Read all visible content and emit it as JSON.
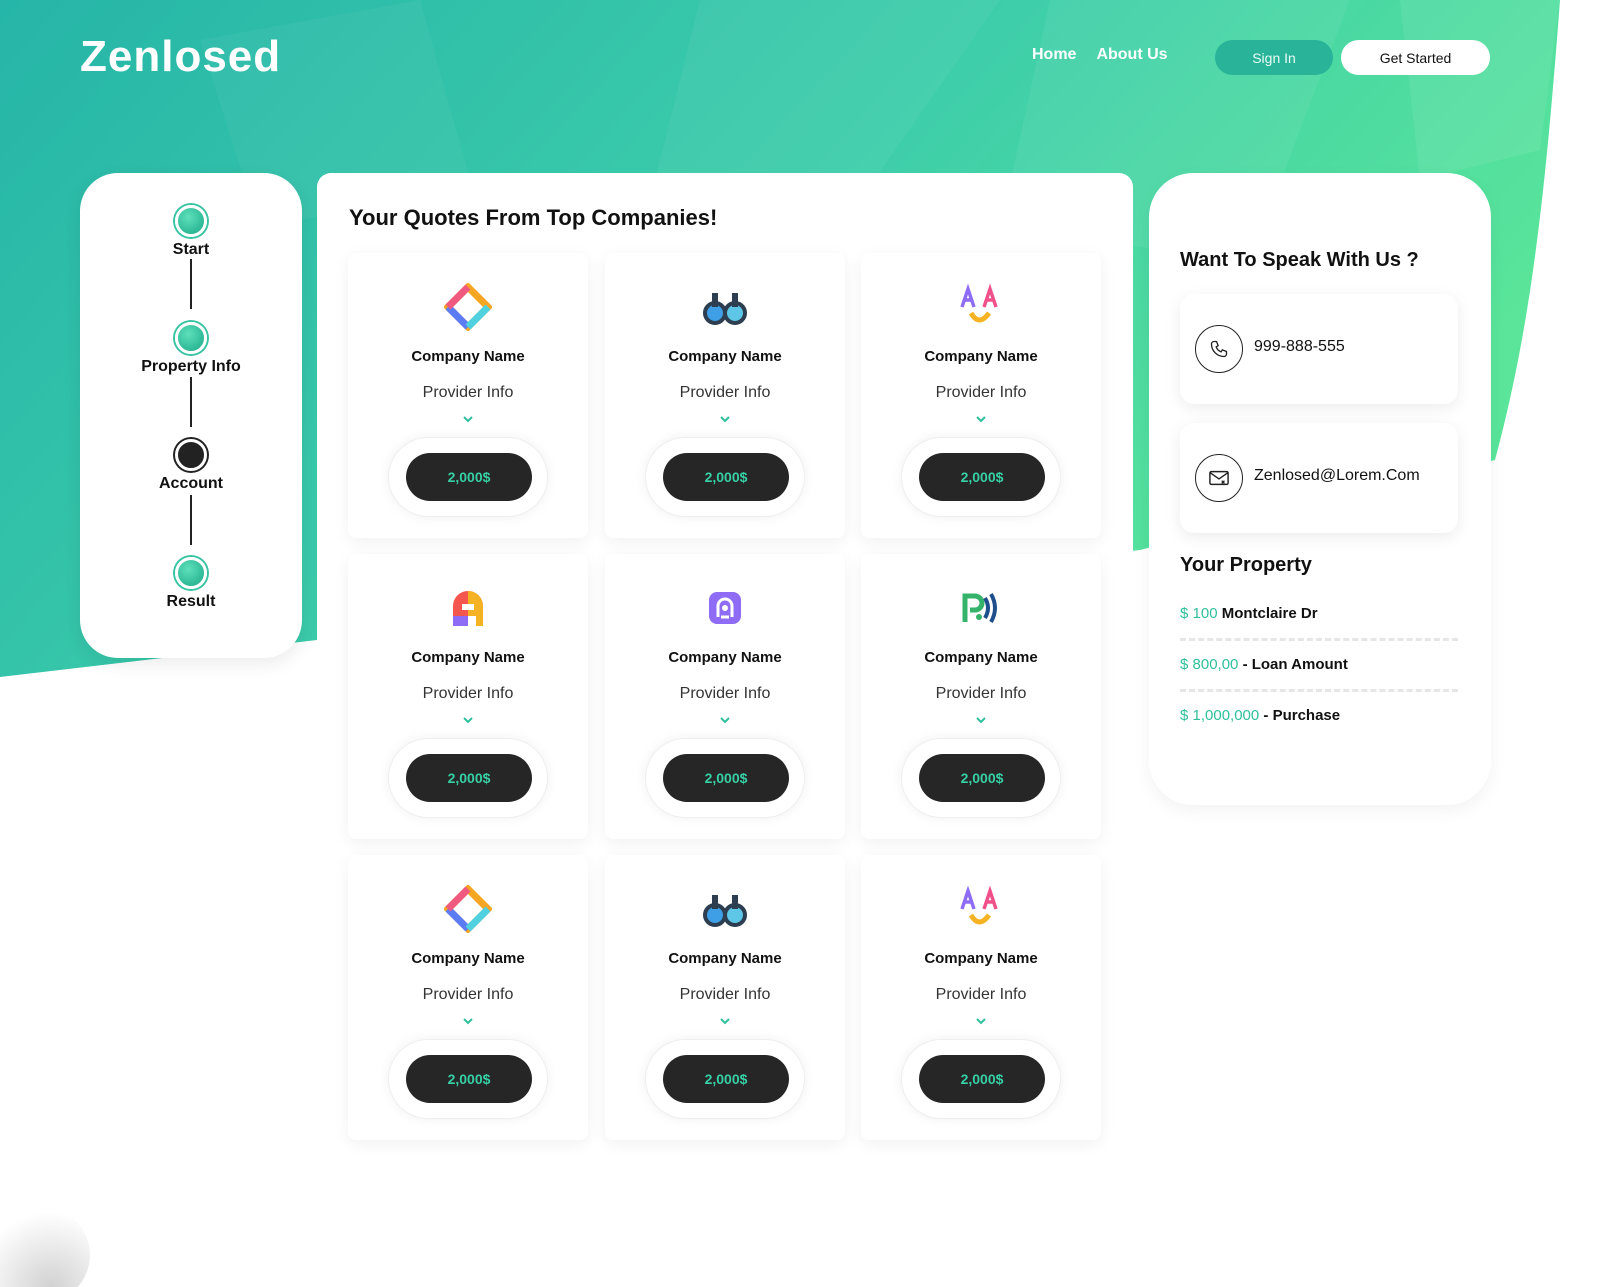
{
  "brand": {
    "logo": "Zenlosed"
  },
  "nav": {
    "home": "Home",
    "about": "About Us",
    "sign_in": "Sign In",
    "get_started": "Get Started"
  },
  "steps": [
    {
      "label": "Start",
      "state": "done"
    },
    {
      "label": "Property Info",
      "state": "done"
    },
    {
      "label": "Account",
      "state": "current"
    },
    {
      "label": "Result",
      "state": "done"
    }
  ],
  "quotes": {
    "title": "Your Quotes From Top Companies!",
    "cards": [
      {
        "icon": "diamond-logo-icon",
        "name": "Company Name",
        "info": "Provider Info",
        "price": "2,000$"
      },
      {
        "icon": "binoculars-logo-icon",
        "name": "Company Name",
        "info": "Provider Info",
        "price": "2,000$"
      },
      {
        "icon": "aa-smile-logo-icon",
        "name": "Company Name",
        "info": "Provider Info",
        "price": "2,000$"
      },
      {
        "icon": "a-letter-logo-icon",
        "name": "Company Name",
        "info": "Provider Info",
        "price": "2,000$"
      },
      {
        "icon": "purple-badge-logo-icon",
        "name": "Company Name",
        "info": "Provider Info",
        "price": "2,000$"
      },
      {
        "icon": "p-signal-logo-icon",
        "name": "Company Name",
        "info": "Provider Info",
        "price": "2,000$"
      },
      {
        "icon": "diamond-logo-icon",
        "name": "Company Name",
        "info": "Provider Info",
        "price": "2,000$"
      },
      {
        "icon": "binoculars-logo-icon",
        "name": "Company Name",
        "info": "Provider Info",
        "price": "2,000$"
      },
      {
        "icon": "aa-smile-logo-icon",
        "name": "Company Name",
        "info": "Provider Info",
        "price": "2,000$"
      }
    ]
  },
  "contact": {
    "title": "Want To Speak With Us ?",
    "phone": "999-888-555",
    "email": "Zenlosed@Lorem.Com"
  },
  "property": {
    "title": "Your Property",
    "address_amount": "$ 100",
    "address_text": "Montclaire Dr",
    "loan_amount": "$ 800,00",
    "loan_text": "- Loan Amount",
    "purchase_amount": "$ 1,000,000",
    "purchase_text": "- Purchase"
  },
  "colors": {
    "accent": "#2fbf9c",
    "hero_start": "#25b6a6",
    "hero_end": "#56e39a",
    "dark_button": "#262626"
  }
}
